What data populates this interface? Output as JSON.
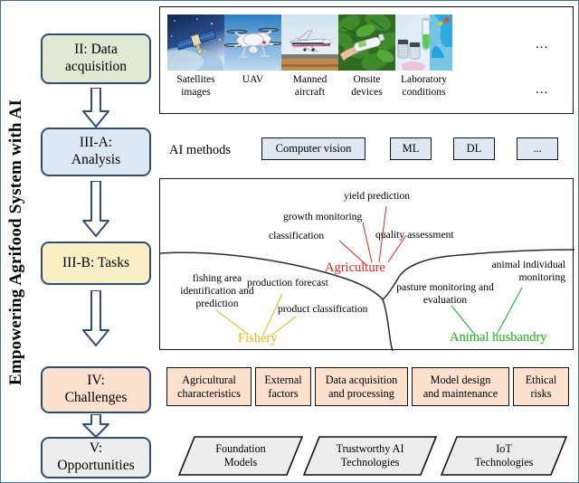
{
  "figure": {
    "vertical_title": "Empowering Agrifood System with AI"
  },
  "stages": [
    {
      "id": "data-acquisition",
      "line1": "II: Data",
      "line2": "acquisition",
      "color": "#dfe9d4"
    },
    {
      "id": "analysis",
      "line1": "III-A:",
      "line2": "Analysis",
      "color": "#dbe7f3"
    },
    {
      "id": "tasks",
      "line1": "III-B: Tasks",
      "line2": "",
      "color": "#faeec5"
    },
    {
      "id": "challenges",
      "line1": "IV:",
      "line2": "Challenges",
      "color": "#fae0cd"
    },
    {
      "id": "opportunities",
      "line1": "V:",
      "line2": "Opportunities",
      "color": "#ededed"
    }
  ],
  "data_acquisition": {
    "sources": [
      {
        "id": "satellite",
        "label_line1": "Satellites",
        "label_line2": "images"
      },
      {
        "id": "uav",
        "label_line1": "UAV",
        "label_line2": ""
      },
      {
        "id": "aircraft",
        "label_line1": "Manned",
        "label_line2": "aircraft"
      },
      {
        "id": "onsite",
        "label_line1": "Onsite",
        "label_line2": "devices"
      },
      {
        "id": "laboratory",
        "label_line1": "Laboratory",
        "label_line2": "conditions"
      }
    ],
    "ellipsis_top": "...",
    "ellipsis_bottom": "..."
  },
  "analysis": {
    "label": "AI methods",
    "methods": [
      {
        "id": "computer-vision",
        "label": "Computer vision"
      },
      {
        "id": "ml",
        "label": "ML"
      },
      {
        "id": "dl",
        "label": "DL"
      },
      {
        "id": "more",
        "label": "..."
      }
    ]
  },
  "tasks": {
    "domains": [
      {
        "id": "agriculture",
        "label": "Agriculture",
        "color": "#e8221a"
      },
      {
        "id": "fishery",
        "label": "Fishery",
        "color": "#f5b415"
      },
      {
        "id": "animal-husbandry",
        "label": "Animal husbandry",
        "color": "#11b311"
      }
    ],
    "agriculture_tasks": [
      {
        "id": "yield-prediction",
        "label": "yield prediction"
      },
      {
        "id": "growth-monitoring",
        "label": "growth monitoring"
      },
      {
        "id": "classification",
        "label": "classification"
      },
      {
        "id": "quality-assessment",
        "label": "quality assessment"
      }
    ],
    "fishery_tasks": [
      {
        "id": "fishing-area",
        "label": "fishing area identification and prediction"
      },
      {
        "id": "production-forecast",
        "label": "production forecast"
      },
      {
        "id": "product-classification",
        "label": "product classification"
      }
    ],
    "animal_tasks": [
      {
        "id": "pasture-monitoring",
        "label": "pasture monitoring and evaluation"
      },
      {
        "id": "animal-individual",
        "label": "animal individual monitoring"
      }
    ]
  },
  "challenges": {
    "items": [
      {
        "id": "agricultural-characteristics",
        "line1": "Agricultural",
        "line2": "characteristics"
      },
      {
        "id": "external-factors",
        "line1": "External",
        "line2": "factors"
      },
      {
        "id": "data-acquisition-processing",
        "line1": "Data acquisition",
        "line2": "and processing"
      },
      {
        "id": "model-design-maintenance",
        "line1": "Model design",
        "line2": "and maintenance"
      },
      {
        "id": "ethical-risks",
        "line1": "Ethical",
        "line2": "risks"
      }
    ]
  },
  "opportunities": {
    "items": [
      {
        "id": "foundation-models",
        "line1": "Foundation",
        "line2": "Models"
      },
      {
        "id": "trustworthy-ai",
        "line1": "Trustworthy AI",
        "line2": "Technologies"
      },
      {
        "id": "iot-technologies",
        "line1": "IoT",
        "line2": "Technologies"
      }
    ]
  }
}
